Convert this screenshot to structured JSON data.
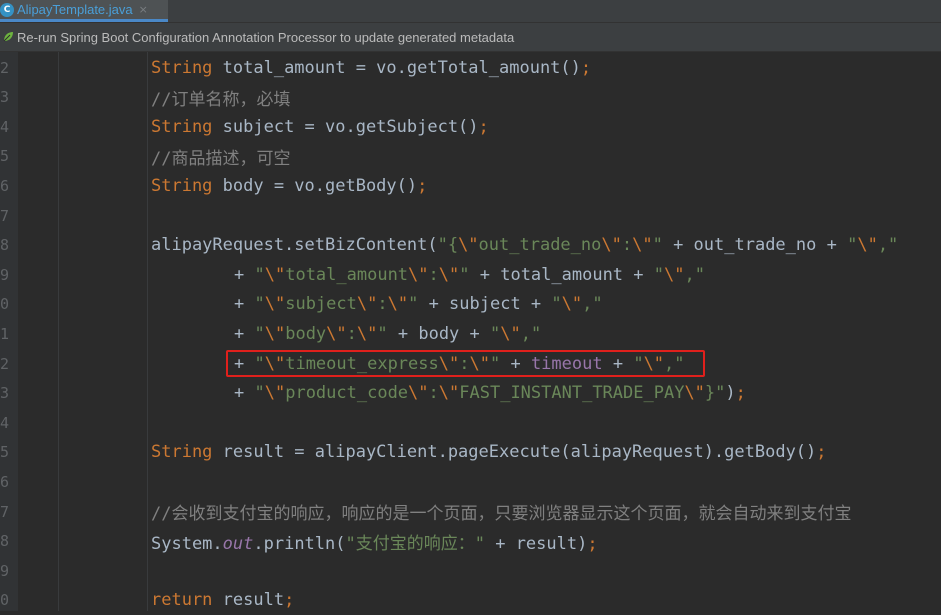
{
  "tab": {
    "filename": "AlipayTemplate.java",
    "close_glyph": "×",
    "icon": "java-class-icon",
    "icon_letter": "C"
  },
  "banner": {
    "icon": "spring-leaf-icon",
    "text": "Re-run Spring Boot Configuration Annotation Processor to update generated metadata"
  },
  "colors": {
    "keyword": "#cc7832",
    "string": "#6a8759",
    "comment": "#808080",
    "field": "#9876aa",
    "default": "#a9b7c6",
    "highlight_box": "#e0201c"
  },
  "lines": [
    {
      "num": "2",
      "tokens": [
        [
          "kw",
          "String"
        ],
        [
          "p",
          " total_amount = vo.getTotal_amount()"
        ],
        [
          "kw",
          ";"
        ]
      ]
    },
    {
      "num": "3",
      "tokens": [
        [
          "com",
          "//订单名称，必填"
        ]
      ]
    },
    {
      "num": "4",
      "tokens": [
        [
          "kw",
          "String"
        ],
        [
          "p",
          " subject = vo.getSubject()"
        ],
        [
          "kw",
          ";"
        ]
      ]
    },
    {
      "num": "5",
      "tokens": [
        [
          "com",
          "//商品描述，可空"
        ]
      ]
    },
    {
      "num": "6",
      "tokens": [
        [
          "kw",
          "String"
        ],
        [
          "p",
          " body = vo.getBody()"
        ],
        [
          "kw",
          ";"
        ]
      ]
    },
    {
      "num": "7",
      "tokens": []
    },
    {
      "num": "8",
      "tokens": [
        [
          "p",
          "alipayRequest.setBizContent("
        ],
        [
          "str",
          "\"{"
        ],
        [
          "esc",
          "\\\""
        ],
        [
          "str",
          "out_trade_no"
        ],
        [
          "esc",
          "\\\""
        ],
        [
          "str",
          ":"
        ],
        [
          "esc",
          "\\\""
        ],
        [
          "str",
          "\""
        ],
        [
          "p",
          " + out_trade_no + "
        ],
        [
          "str",
          "\""
        ],
        [
          "esc",
          "\\\""
        ],
        [
          "str",
          ",\""
        ]
      ]
    },
    {
      "num": "9",
      "cont": true,
      "tokens": [
        [
          "p",
          "+ "
        ],
        [
          "str",
          "\""
        ],
        [
          "esc",
          "\\\""
        ],
        [
          "str",
          "total_amount"
        ],
        [
          "esc",
          "\\\""
        ],
        [
          "str",
          ":"
        ],
        [
          "esc",
          "\\\""
        ],
        [
          "str",
          "\""
        ],
        [
          "p",
          " + total_amount + "
        ],
        [
          "str",
          "\""
        ],
        [
          "esc",
          "\\\""
        ],
        [
          "str",
          ",\""
        ]
      ]
    },
    {
      "num": "0",
      "cont": true,
      "tokens": [
        [
          "p",
          "+ "
        ],
        [
          "str",
          "\""
        ],
        [
          "esc",
          "\\\""
        ],
        [
          "str",
          "subject"
        ],
        [
          "esc",
          "\\\""
        ],
        [
          "str",
          ":"
        ],
        [
          "esc",
          "\\\""
        ],
        [
          "str",
          "\""
        ],
        [
          "p",
          " + subject + "
        ],
        [
          "str",
          "\""
        ],
        [
          "esc",
          "\\\""
        ],
        [
          "str",
          ",\""
        ]
      ]
    },
    {
      "num": "1",
      "cont": true,
      "tokens": [
        [
          "p",
          "+ "
        ],
        [
          "str",
          "\""
        ],
        [
          "esc",
          "\\\""
        ],
        [
          "str",
          "body"
        ],
        [
          "esc",
          "\\\""
        ],
        [
          "str",
          ":"
        ],
        [
          "esc",
          "\\\""
        ],
        [
          "str",
          "\""
        ],
        [
          "p",
          " + body + "
        ],
        [
          "str",
          "\""
        ],
        [
          "esc",
          "\\\""
        ],
        [
          "str",
          ",\""
        ]
      ]
    },
    {
      "num": "2",
      "cont": true,
      "tokens": [
        [
          "p",
          "+ "
        ],
        [
          "str",
          "\""
        ],
        [
          "esc",
          "\\\""
        ],
        [
          "str",
          "timeout_express"
        ],
        [
          "esc",
          "\\\""
        ],
        [
          "str",
          ":"
        ],
        [
          "esc",
          "\\\""
        ],
        [
          "str",
          "\""
        ],
        [
          "p",
          " + "
        ],
        [
          "fld",
          "timeout"
        ],
        [
          "p",
          " + "
        ],
        [
          "str",
          "\""
        ],
        [
          "esc",
          "\\\""
        ],
        [
          "str",
          ",\""
        ]
      ]
    },
    {
      "num": "3",
      "cont": true,
      "tokens": [
        [
          "p",
          "+ "
        ],
        [
          "str",
          "\""
        ],
        [
          "esc",
          "\\\""
        ],
        [
          "str",
          "product_code"
        ],
        [
          "esc",
          "\\\""
        ],
        [
          "str",
          ":"
        ],
        [
          "esc",
          "\\\""
        ],
        [
          "str",
          "FAST_INSTANT_TRADE_PAY"
        ],
        [
          "esc",
          "\\\""
        ],
        [
          "str",
          "}\""
        ],
        [
          "p",
          ")"
        ],
        [
          "kw",
          ";"
        ]
      ]
    },
    {
      "num": "4",
      "tokens": []
    },
    {
      "num": "5",
      "tokens": [
        [
          "kw",
          "String"
        ],
        [
          "p",
          " result = alipayClient.pageExecute(alipayRequest).getBody()"
        ],
        [
          "kw",
          ";"
        ]
      ]
    },
    {
      "num": "6",
      "tokens": []
    },
    {
      "num": "7",
      "tokens": [
        [
          "com",
          "//会收到支付宝的响应，响应的是一个页面，只要浏览器显示这个页面，就会自动来到支付宝"
        ]
      ]
    },
    {
      "num": "8",
      "tokens": [
        [
          "p",
          "System."
        ],
        [
          "sfld",
          "out"
        ],
        [
          "p",
          ".println("
        ],
        [
          "str",
          "\"支付宝的响应：\""
        ],
        [
          "p",
          " + result)"
        ],
        [
          "kw",
          ";"
        ]
      ]
    },
    {
      "num": "9",
      "tokens": []
    },
    {
      "num": "0",
      "tokens": [
        [
          "kw",
          "return"
        ],
        [
          "p",
          " result"
        ],
        [
          "kw",
          ";"
        ]
      ]
    }
  ]
}
